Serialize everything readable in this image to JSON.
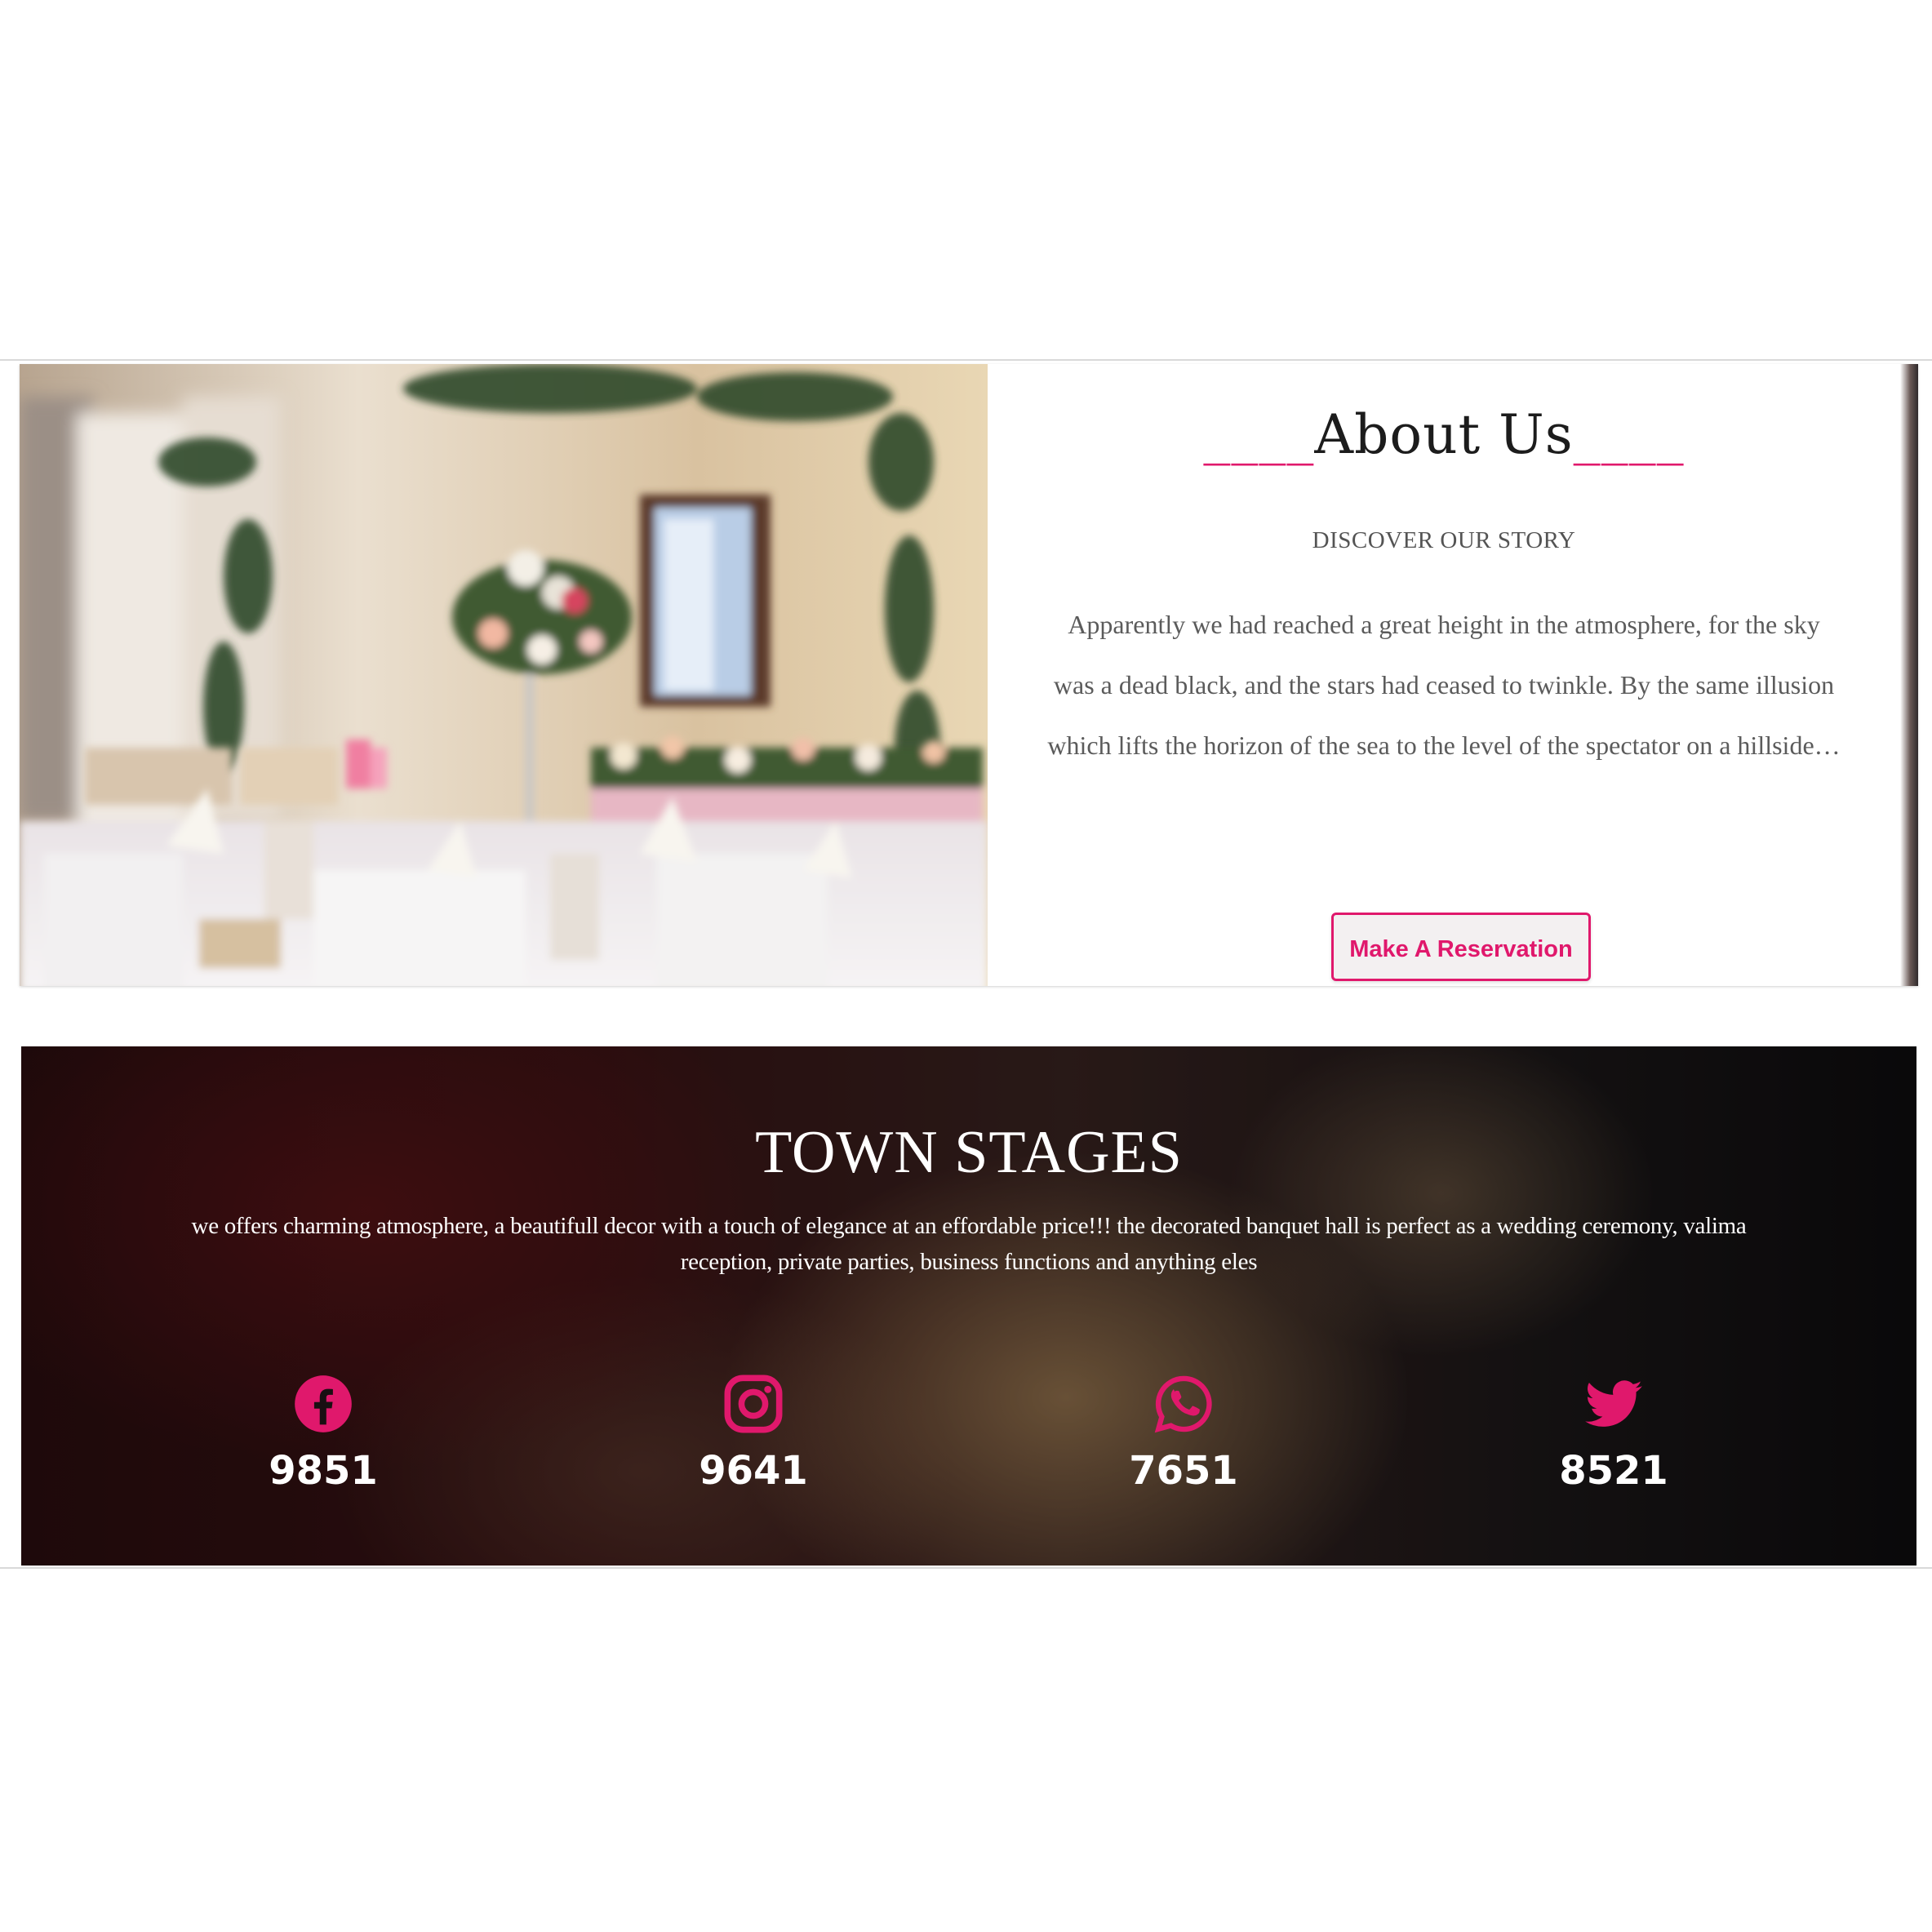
{
  "about": {
    "title": "About Us",
    "title_decoration": "____",
    "subtitle": "DISCOVER OUR STORY",
    "text": "Apparently we had reached a great height in the atmosphere, for the sky was a dead black, and the stars had ceased to twinkle. By the same illusion which lifts the horizon of the sea to the level of the spectator on a hillside…",
    "button_label": "Make A Reservation"
  },
  "stats": {
    "title": "TOWN STAGES",
    "description": "we offers charming atmosphere, a beautifull decor with a touch of elegance at an effordable price!!! the decorated banquet hall is perfect as a wedding ceremony, valima reception, private parties, business functions and anything eles",
    "items": [
      {
        "icon": "facebook-icon",
        "value": "9851"
      },
      {
        "icon": "instagram-icon",
        "value": "9641"
      },
      {
        "icon": "whatsapp-icon",
        "value": "7651"
      },
      {
        "icon": "twitter-icon",
        "value": "8521"
      }
    ]
  },
  "colors": {
    "accent": "#e0186c",
    "dark_bg": "#1a1214",
    "text_gray": "#5b5b5b"
  }
}
